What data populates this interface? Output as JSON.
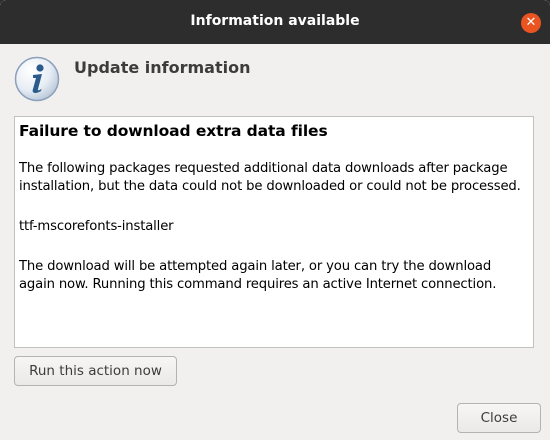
{
  "window": {
    "title": "Information available"
  },
  "header": {
    "title": "Update information",
    "icon": "info-icon"
  },
  "content": {
    "heading": "Failure to download extra data files",
    "paragraph1": "The following packages requested additional data downloads after package installation, but the data could not be downloaded or could not be processed.",
    "package": "ttf-mscorefonts-installer",
    "paragraph2": "The download will be attempted again later, or you can try the download again now. Running this command requires an active Internet connection."
  },
  "buttons": {
    "run_action": "Run this action now",
    "close": "Close",
    "close_x": "✕"
  },
  "colors": {
    "titlebar": "#2d2d2d",
    "close_accent": "#e95420",
    "info_icon": "#2a5b8c"
  }
}
